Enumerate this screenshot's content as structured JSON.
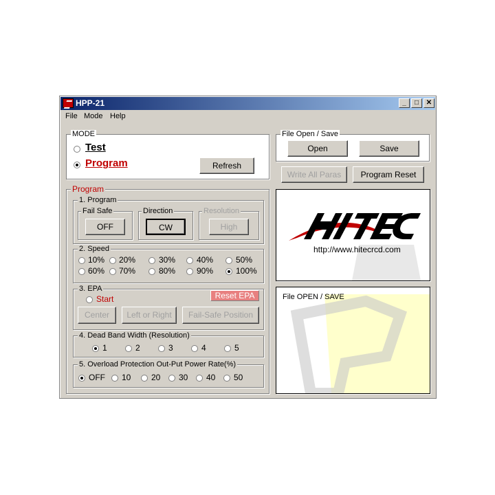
{
  "window": {
    "title": "HPP-21",
    "minimize": "_",
    "maximize": "□",
    "close": "✕"
  },
  "menu": [
    "File",
    "Mode",
    "Help"
  ],
  "mode": {
    "legend": "MODE",
    "test_label": "Test",
    "program_label": "Program",
    "refresh_label": "Refresh",
    "selected": "Program"
  },
  "file": {
    "legend": "File Open / Save",
    "open_label": "Open",
    "save_label": "Save",
    "write_all_label": "Write All Paras",
    "program_reset_label": "Program Reset"
  },
  "logo": {
    "brand_text": "HITEC",
    "url_text": "http://www.hitecrcd.com"
  },
  "status_panel": {
    "label": "File OPEN / SAVE"
  },
  "program": {
    "legend": "Program",
    "sub1": {
      "legend": "1. Program",
      "fail_safe": {
        "legend": "Fail Safe",
        "button": "OFF"
      },
      "direction": {
        "legend": "Direction",
        "button": "CW"
      },
      "resolution": {
        "legend": "Resolution",
        "button": "High"
      }
    },
    "speed": {
      "legend": "2. Speed",
      "options": [
        "10%",
        "20%",
        "30%",
        "40%",
        "50%",
        "60%",
        "70%",
        "80%",
        "90%",
        "100%"
      ],
      "selected": "100%"
    },
    "epa": {
      "legend": "3. EPA",
      "start_label": "Start",
      "reset_label": "Reset EPA",
      "center_label": "Center",
      "left_right_label": "Left or Right",
      "fail_safe_pos_label": "Fail-Safe Position"
    },
    "dead_band": {
      "legend": "4. Dead Band Width (Resolution)",
      "options": [
        "1",
        "2",
        "3",
        "4",
        "5"
      ],
      "selected": "1"
    },
    "overload": {
      "legend": "5. Overload Protection Out-Put Power Rate(%)",
      "options": [
        "OFF",
        "10",
        "20",
        "30",
        "40",
        "50"
      ],
      "selected": "OFF"
    }
  },
  "colors": {
    "title_bar": "#0a246a",
    "accent_red": "#c00000",
    "reset_epa_bg": "#e88080",
    "status_fill": "#ffffcc"
  }
}
